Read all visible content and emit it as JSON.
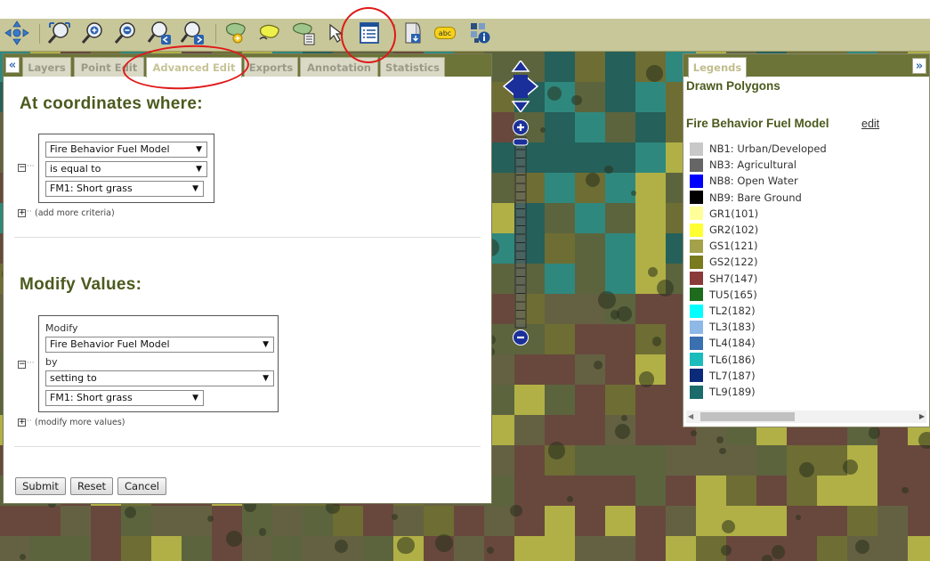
{
  "toolbar": {
    "tools": [
      {
        "name": "pan-icon"
      },
      {
        "name": "zoom-extent-icon"
      },
      {
        "name": "zoom-in-icon"
      },
      {
        "name": "zoom-out-icon"
      },
      {
        "name": "zoom-previous-icon"
      },
      {
        "name": "zoom-next-icon"
      },
      {
        "name": "draw-polygon-icon"
      },
      {
        "name": "select-polygon-icon"
      },
      {
        "name": "polygon-table-icon"
      },
      {
        "name": "select-arrow-icon"
      },
      {
        "name": "attribute-table-icon"
      },
      {
        "name": "export-icon"
      },
      {
        "name": "label-icon"
      },
      {
        "name": "info-icon"
      }
    ],
    "label_text": "abc"
  },
  "left_panel": {
    "collapse_glyph": "«",
    "tabs": [
      "Layers",
      "Point Edit",
      "Advanced Edit",
      "Exports",
      "Annotation",
      "Statistics"
    ],
    "active_tab": "Advanced Edit",
    "coords_title": "At coordinates where:",
    "criteria": {
      "field": "Fire Behavior Fuel Model",
      "operator": "is equal to",
      "value": "FM1: Short grass"
    },
    "add_criteria": "(add more criteria)",
    "modify_title": "Modify Values:",
    "modify": {
      "modify_label": "Modify",
      "field": "Fire Behavior Fuel Model",
      "by_label": "by",
      "method": "setting to",
      "value": "FM1: Short grass"
    },
    "add_modify": "(modify more values)",
    "buttons": {
      "submit": "Submit",
      "reset": "Reset",
      "cancel": "Cancel"
    }
  },
  "legend_panel": {
    "tab": "Legends",
    "expand_glyph": "»",
    "drawn_polygons": "Drawn Polygons",
    "layer_title": "Fire Behavior Fuel Model",
    "edit_link": "edit",
    "items": [
      {
        "label": "NB1: Urban/Developed",
        "color": "#c8c8c8"
      },
      {
        "label": "NB3: Agricultural",
        "color": "#666666"
      },
      {
        "label": "NB8: Open Water",
        "color": "#0000ff"
      },
      {
        "label": "NB9: Bare Ground",
        "color": "#000000"
      },
      {
        "label": "GR1(101)",
        "color": "#ffff99"
      },
      {
        "label": "GR2(102)",
        "color": "#ffff33"
      },
      {
        "label": "GS1(121)",
        "color": "#a3a24a"
      },
      {
        "label": "GS2(122)",
        "color": "#7a7a1f"
      },
      {
        "label": "SH7(147)",
        "color": "#8b3a3a"
      },
      {
        "label": "TU5(165)",
        "color": "#1e6b1e"
      },
      {
        "label": "TL2(182)",
        "color": "#00ffff"
      },
      {
        "label": "TL3(183)",
        "color": "#8eb8e6"
      },
      {
        "label": "TL4(184)",
        "color": "#3a6fb0"
      },
      {
        "label": "TL6(186)",
        "color": "#1abcbc"
      },
      {
        "label": "TL7(187)",
        "color": "#0b2a7a"
      },
      {
        "label": "TL9(189)",
        "color": "#1b6b6b"
      }
    ]
  },
  "colors": {
    "toolbar": "#c8c79a",
    "tab_bar": "#6c7437",
    "heading": "#4b5a1e",
    "annotation": "#e01818"
  }
}
